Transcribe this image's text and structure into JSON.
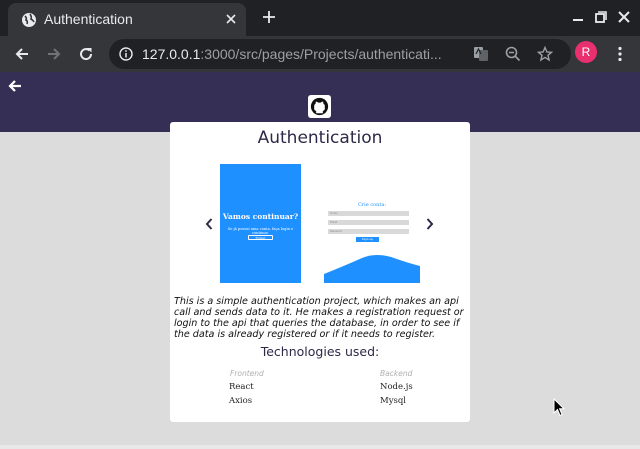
{
  "browser": {
    "tab_title": "Authentication",
    "url_host": "127.0.0.1",
    "url_rest": ":3000/src/pages/Projects/authenticati...",
    "profile_initial": "R"
  },
  "card": {
    "title": "Authentication",
    "slide1": {
      "heading": "Vamos continuar?",
      "text": "Se já possuí uma conta, faça login e continue.",
      "button": "Entrar"
    },
    "slide2": {
      "heading": "Crie conta:",
      "field_name": "Nome",
      "field_email": "Email",
      "field_password": "Password",
      "button": "Sign up"
    },
    "description": "This is a simple authentication project, which makes an api call and sends data to it. He makes a registration request or login to the api that queries the database, in order to see if the data is already registered or if it needs to register.",
    "tech_title": "Technologies used:",
    "frontend_label": "Frontend",
    "backend_label": "Backend",
    "frontend_items": [
      "React",
      "Axios"
    ],
    "backend_items": [
      "Node.js",
      "Mysql"
    ]
  },
  "colors": {
    "header_bg": "#352f56",
    "slide_blue": "#1e90ff",
    "page_bg": "#dcdcdc",
    "avatar": "#e8306e"
  },
  "icons": [
    "globe-icon",
    "close-icon",
    "plus-icon",
    "minimize-icon",
    "maximize-icon",
    "window-close-icon",
    "back-icon",
    "forward-icon",
    "reload-icon",
    "info-icon",
    "translate-icon",
    "zoom-out-icon",
    "star-icon",
    "kebab-menu-icon",
    "arrow-left-icon",
    "github-icon",
    "chevron-left-icon",
    "chevron-right-icon",
    "cursor-icon"
  ]
}
